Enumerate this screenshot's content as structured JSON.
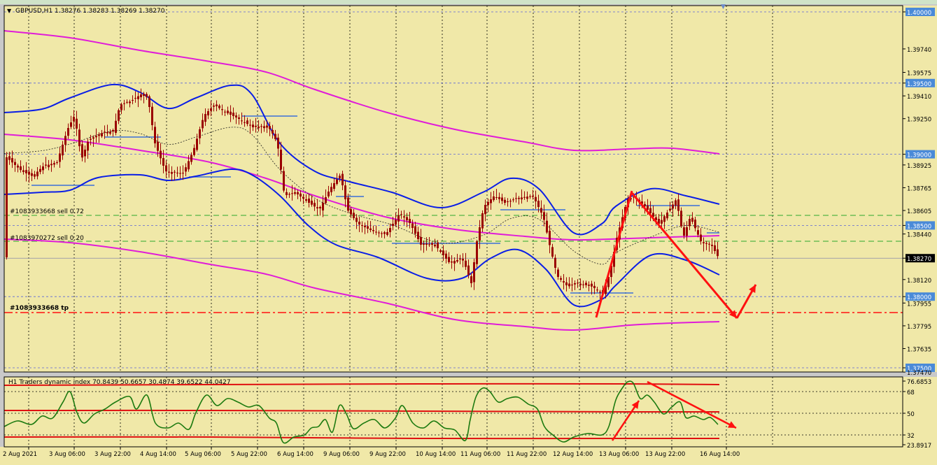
{
  "symbol_header": "GBPUSD,H1  1.38276 1.38283 1.38269 1.38270",
  "price_axis": {
    "levels": [
      {
        "label": "1.40000",
        "value": 1.4,
        "highlight": true
      },
      {
        "label": "1.39740",
        "value": 1.3974
      },
      {
        "label": "1.39575",
        "value": 1.39575
      },
      {
        "label": "1.39500",
        "value": 1.395,
        "highlight": true
      },
      {
        "label": "1.39410",
        "value": 1.3941
      },
      {
        "label": "1.39250",
        "value": 1.3925
      },
      {
        "label": "1.39000",
        "value": 1.39,
        "highlight": true
      },
      {
        "label": "1.38925",
        "value": 1.38925
      },
      {
        "label": "1.38765",
        "value": 1.38765
      },
      {
        "label": "1.38605",
        "value": 1.38605
      },
      {
        "label": "1.38500",
        "value": 1.385,
        "highlight": true
      },
      {
        "label": "1.38440",
        "value": 1.3844
      },
      {
        "label": "1.38270",
        "value": 1.3827,
        "current": true
      },
      {
        "label": "1.38120",
        "value": 1.3812
      },
      {
        "label": "1.38000",
        "value": 1.38,
        "highlight": true
      },
      {
        "label": "1.37955",
        "value": 1.37955
      },
      {
        "label": "1.37795",
        "value": 1.37795
      },
      {
        "label": "1.37635",
        "value": 1.37635
      },
      {
        "label": "1.37500",
        "value": 1.375,
        "highlight": true
      },
      {
        "label": "1.37470",
        "value": 1.3747
      }
    ]
  },
  "order_labels": {
    "sell_1": "#1083933668 sell 0.72",
    "sell_2": "#1083970272 sell 0.20",
    "tp": "#1083933668 tp"
  },
  "indicator": {
    "header": "H1 Traders dynamic index 70.8439 50.6657 30.4874 39.6522 44.0427",
    "scale_labels": [
      "76.6853",
      "68",
      "50",
      "32",
      "23.8917"
    ]
  },
  "time_axis": [
    "2 Aug 2021",
    "3 Aug 06:00",
    "3 Aug 22:00",
    "4 Aug 14:00",
    "5 Aug 06:00",
    "5 Aug 22:00",
    "6 Aug 14:00",
    "9 Aug 06:00",
    "9 Aug 22:00",
    "10 Aug 14:00",
    "11 Aug 06:00",
    "11 Aug 22:00",
    "12 Aug 14:00",
    "13 Aug 06:00",
    "13 Aug 22:00",
    "16 Aug 14:00"
  ],
  "colors": {
    "background": "#f0e8a8",
    "grid": "#000000",
    "bollinger": "#0a1ee6",
    "envelope": "#e01cd8",
    "candles": "#9a0000",
    "annotation": "#ff1010",
    "tdi_green": "#1c7a10",
    "tdi_red": "#e01010",
    "level_blue": "#3a6fd8",
    "level_green": "#2ca82c"
  }
}
